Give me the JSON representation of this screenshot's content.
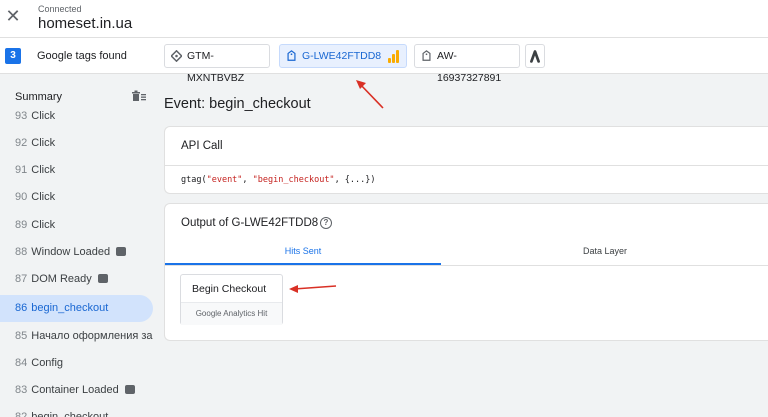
{
  "connection": {
    "status": "Connected",
    "domain": "homeset.in.ua"
  },
  "tags": {
    "count": "3",
    "label": "Google tags found",
    "chips": [
      {
        "id": "GTM-MXNTBVBZ"
      },
      {
        "id": "G-LWE42FTDD8"
      },
      {
        "id": "AW-16937327891"
      }
    ]
  },
  "sidebar": {
    "summary_label": "Summary",
    "events": [
      {
        "num": "93",
        "label": "Click"
      },
      {
        "num": "92",
        "label": "Click"
      },
      {
        "num": "91",
        "label": "Click"
      },
      {
        "num": "90",
        "label": "Click"
      },
      {
        "num": "89",
        "label": "Click"
      },
      {
        "num": "88",
        "label": "Window Loaded"
      },
      {
        "num": "87",
        "label": "DOM Ready"
      },
      {
        "num": "86",
        "label": "begin_checkout"
      },
      {
        "num": "85",
        "label": "Начало оформления за..."
      },
      {
        "num": "84",
        "label": "Config"
      },
      {
        "num": "83",
        "label": "Container Loaded"
      },
      {
        "num": "82",
        "label": "begin_checkout"
      }
    ]
  },
  "main": {
    "event_title": "Event: begin_checkout",
    "api_call": {
      "title": "API Call",
      "code_prefix": "gtag(",
      "code_arg1": "\"event\"",
      "code_sep": ", ",
      "code_arg2": "\"begin_checkout\"",
      "code_suffix": ", {...})"
    },
    "output": {
      "title": "Output of G-LWE42FTDD8",
      "tabs": [
        "Hits Sent",
        "Data Layer"
      ],
      "hit": {
        "name": "Begin Checkout",
        "type": "Google Analytics Hit"
      }
    }
  },
  "colors": {
    "accent": "#1a73e8",
    "annotation_arrow": "#d93025",
    "ga_bars": "#f9ab00"
  }
}
